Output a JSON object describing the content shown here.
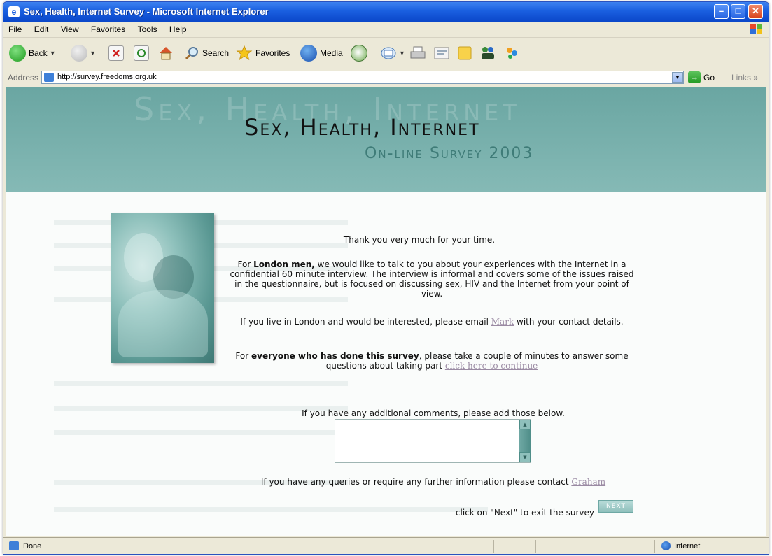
{
  "window": {
    "title": "Sex, Health, Internet Survey - Microsoft Internet Explorer"
  },
  "menu": [
    "File",
    "Edit",
    "View",
    "Favorites",
    "Tools",
    "Help"
  ],
  "toolbar": {
    "back": "Back",
    "search": "Search",
    "favorites": "Favorites",
    "media": "Media"
  },
  "address": {
    "label": "Address",
    "url": "http://survey.freedoms.org.uk",
    "go": "Go",
    "links": "Links"
  },
  "site": {
    "ghost_title": "Sex, Health, Internet",
    "title": "Sex, Health, Internet",
    "subtitle": "On-line Survey 2003"
  },
  "content": {
    "thanks": "Thank you very much for your time.",
    "london_pre": "For ",
    "london_bold": "London men,",
    "london_post": " we would like to talk to you about your experiences with the Internet in a confidential 60 minute interview. The interview is informal and covers some of the issues raised in the questionnaire, but is focused on discussing sex, HIV and the Internet from your point of view.",
    "email_pre": "If you live in London and would be interested, please email ",
    "email_link": "Mark",
    "email_post": " with your contact details.",
    "everyone_pre": "For ",
    "everyone_bold": "everyone who has done this survey",
    "everyone_post": ", please take a couple of minutes to answer some questions about taking part ",
    "continue_link": "click here to continue",
    "comments_prompt": "If you have any additional comments, please add those below.",
    "comments_value": "",
    "queries_pre": "If you have any queries or require any further information please contact ",
    "queries_link": "Graham",
    "exit_text": "click on \"Next\" to exit the survey",
    "next_label": "NEXT"
  },
  "status": {
    "text": "Done",
    "zone": "Internet"
  }
}
